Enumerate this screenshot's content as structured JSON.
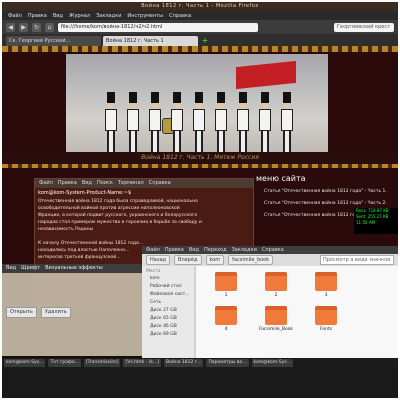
{
  "window": {
    "title": "Война 1812 г. Часть 1 - Mozilla Firefox"
  },
  "browser": {
    "menu": [
      "Файл",
      "Правка",
      "Вид",
      "Журнал",
      "Закладки",
      "Инструменты",
      "Справка"
    ],
    "url": "file:///home/kom/война-1812/ч2/ч2.html",
    "search_placeholder": "Георгиевский крест",
    "tabs": [
      "Ск. Георгиев Русский...",
      "Война 1812 г. Часть 1"
    ]
  },
  "site": {
    "header": "Война 1812 г. Часть 1. Мятеж Россия",
    "article": [
      "Отечественная война 1812 года была справедливой, национально",
      "освободительной войной против агрессии наполеоновской",
      "Франции, в которой подвиг русского, украинского и белорусского",
      "народов стал примером мужества и героизма в борьбе за свободу и",
      "независимость Родины",
      "",
      "К началу Отечественной войны 1812 года...",
      "находились под властью Наполеона...",
      "интересов третьей французской..."
    ],
    "menu_title": "меню сайта",
    "menu_items": [
      "Статья \"Отечественная война 1812 года\" - Часть 1.",
      "Статья \"Отечественная война 1812 года\" - Часть 2.",
      "Статья \"Отечественная война 1812 года\" - Часть 3."
    ]
  },
  "terminal": {
    "menu": [
      "Файл",
      "Правка",
      "Вид",
      "Поиск",
      "Терминал",
      "Справка"
    ],
    "prompt": "kom@kom-System-Product-Name:~$"
  },
  "conky": [
    "Recv: 718.87 KB",
    "Sent: 255.27 KB",
    "11:56 AM"
  ],
  "file_manager": {
    "menu": [
      "Файл",
      "Правка",
      "Вид",
      "Переход",
      "Закладки",
      "Справка"
    ],
    "back_label": "Назад",
    "forward_label": "Вперёд",
    "path_button": "kom",
    "location": "facsimile_book",
    "search_placeholder": "Просмотр а виде значков",
    "sidebar_heading": "Места",
    "sidebar_items": [
      "kom",
      "Рабочий стол",
      "Файловая сист...",
      "Сеть",
      "Диск 27 GB",
      "Диск 65 GB",
      "Диск 46 GB",
      "Диск 69 GB"
    ],
    "folders": [
      "1",
      "2",
      "3",
      "4",
      "Facsimile_Book",
      "Fonts"
    ]
  },
  "bg_panel": {
    "menu": [
      "Вид",
      "Шрифт",
      "Визуальные эффекты"
    ],
    "buttons": [
      "Открыть",
      "Удалить"
    ]
  },
  "taskbar": [
    "kom@kom-Sys...",
    "Тот графа...",
    "[Transmission]",
    "[Vs.html - /k...]",
    "Война 1812 г...",
    "Параметры во...",
    "kom@kom-Sys..."
  ]
}
